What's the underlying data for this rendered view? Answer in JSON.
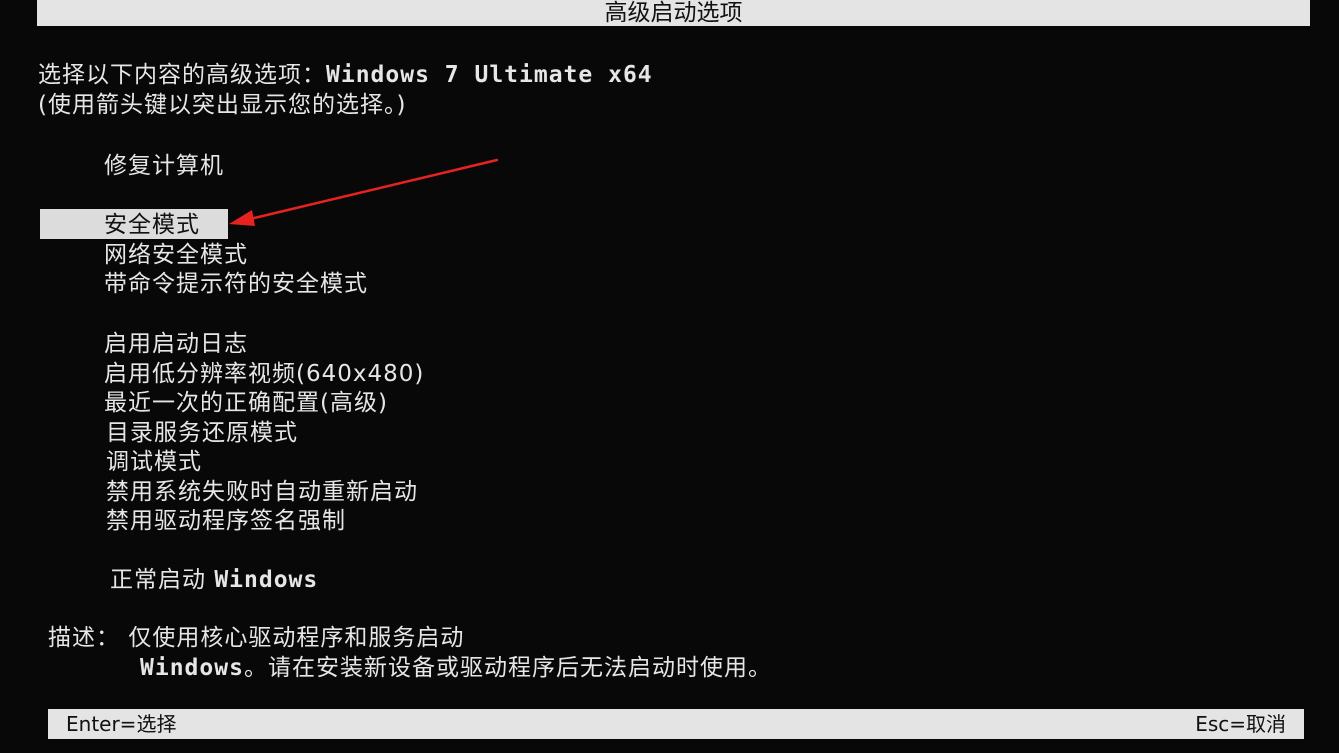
{
  "title": "高级启动选项",
  "header": {
    "line1_prefix": "选择以下内容的高级选项：",
    "line1_os": "Windows 7 Ultimate x64",
    "line2": "(使用箭头键以突出显示您的选择。)"
  },
  "menu": {
    "repair": "修复计算机",
    "safe_mode": "安全模式",
    "safe_mode_network": "网络安全模式",
    "safe_mode_cmd": "带命令提示符的安全模式",
    "boot_logging": "启用启动日志",
    "low_res_video": "启用低分辨率视频(640x480)",
    "last_known_good": "最近一次的正确配置(高级)",
    "ds_restore": "目录服务还原模式",
    "debugging": "调试模式",
    "disable_auto_restart": "禁用系统失败时自动重新启动",
    "disable_driver_sig": "禁用驱动程序签名强制",
    "normal_start_prefix": "正常启动",
    "normal_start_os": "Windows"
  },
  "description": {
    "label": "描述：",
    "line1": "仅使用核心驱动程序和服务启动",
    "line2_prefix": "Windows",
    "line2": "。请在安装新设备或驱动程序后无法启动时使用。"
  },
  "footer": {
    "enter": "Enter=选择",
    "esc": "Esc=取消"
  },
  "colors": {
    "background": "#080808",
    "text": "#e6e6e6",
    "bar": "#e4e4e4",
    "arrow": "#e8231f"
  }
}
